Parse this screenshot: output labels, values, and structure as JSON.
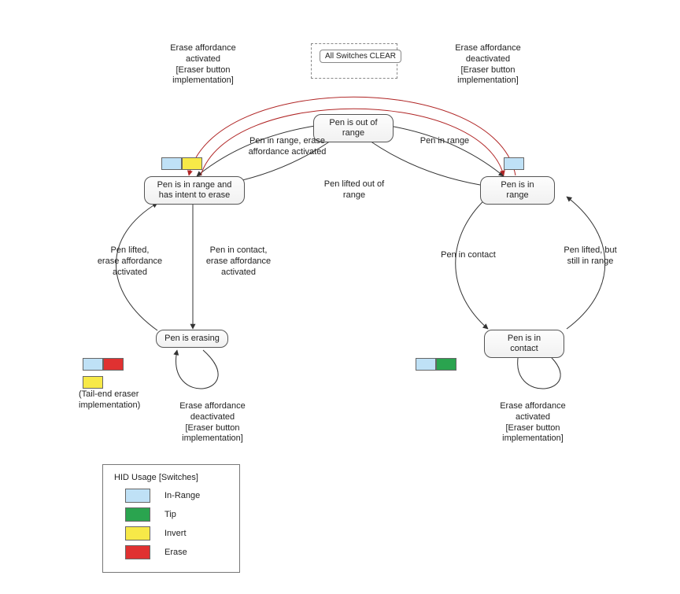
{
  "hub_outer_label": "All Switches CLEAR",
  "states": {
    "out_of_range": "Pen is out of range",
    "in_range_erase": "Pen is in range and\nhas intent to erase",
    "in_range": "Pen is in range",
    "erasing": "Pen is erasing",
    "in_contact": "Pen is in contact"
  },
  "edges": {
    "erase_affordance_activated_top": "Erase affordance\nactivated\n[Eraser button\nimplementation]",
    "erase_affordance_deactivated_top": "Erase affordance\ndeactivated\n[Eraser button\nimplementation]",
    "pen_in_range_erase": "Pen in range, erase\naffordance activated",
    "pen_in_range": "Pen in range",
    "pen_lifted_out": "Pen lifted out of\nrange",
    "pen_lifted_erase": "Pen lifted,\nerase affordance\nactivated",
    "pen_in_contact_erase": "Pen in contact,\nerase affordance\nactivated",
    "pen_in_contact": "Pen in contact",
    "pen_lifted_in_range": "Pen lifted, but\nstill in range",
    "erase_affordance_deact_loop": "Erase affordance\ndeactivated\n[Eraser button\nimplementation]",
    "erase_affordance_act_loop": "Erase affordance\nactivated\n[Eraser button\nimplementation]",
    "tail_end": "(Tail-end eraser\nimplementation)"
  },
  "legend": {
    "title": "HID Usage [Switches]",
    "inrange": "In-Range",
    "tip": "Tip",
    "invert": "Invert",
    "erase": "Erase"
  },
  "colors": {
    "inrange": "#bfe1f6",
    "tip": "#2aa44f",
    "invert": "#f7e948",
    "erase": "#e03131",
    "edge_red": "#b02525"
  }
}
